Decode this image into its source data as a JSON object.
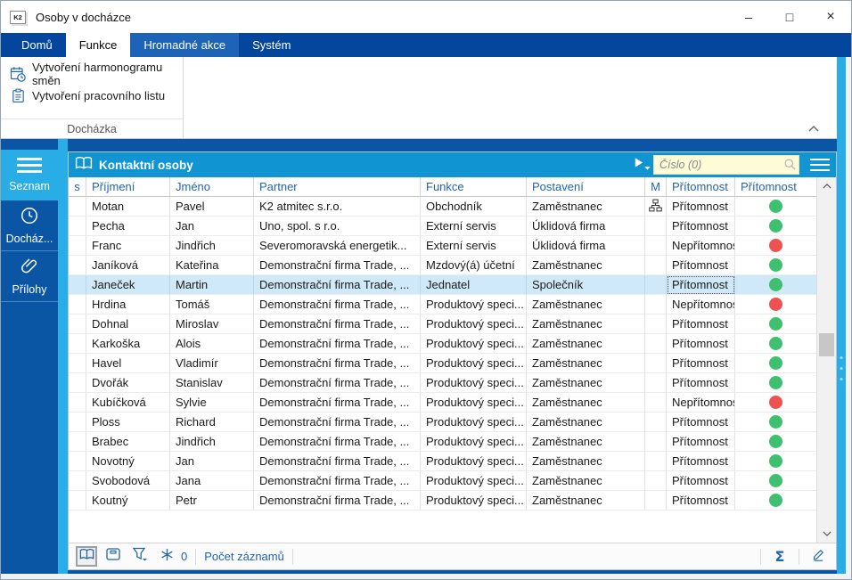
{
  "window": {
    "title": "Osoby v docházce",
    "logo": "K2",
    "controls": {
      "minimize": "–",
      "maximize": "□",
      "close": "×"
    }
  },
  "ribbon": {
    "tabs": [
      {
        "label": "Domů",
        "state": "normal"
      },
      {
        "label": "Funkce",
        "state": "active"
      },
      {
        "label": "Hromadné akce",
        "state": "highlighted"
      },
      {
        "label": "Systém",
        "state": "normal"
      }
    ],
    "group_label": "Docházka",
    "items": [
      {
        "label": "Vytvoření harmonogramu směn",
        "icon": "calendar-clock-icon"
      },
      {
        "label": "Vytvoření pracovního listu",
        "icon": "clipboard-icon"
      }
    ]
  },
  "sidebar": {
    "items": [
      {
        "label": "Seznam",
        "icon": "menu-icon",
        "active": true
      },
      {
        "label": "Docház...",
        "icon": "clock-icon",
        "active": false
      },
      {
        "label": "Přílohy",
        "icon": "paperclip-icon",
        "active": false
      }
    ]
  },
  "panel": {
    "title": "Kontaktní osoby",
    "search_placeholder": "Číslo (0)",
    "columns": [
      "s",
      "Příjmení",
      "Jméno",
      "Partner",
      "Funkce",
      "Postavení",
      "M",
      "Přítomnost",
      "Přítomnost"
    ],
    "rows": [
      {
        "last": "Motan",
        "first": "Pavel",
        "partner": "K2 atmitec s.r.o.",
        "role": "Obchodník",
        "position": "Zaměstnanec",
        "m": true,
        "presence": "Přítomnost",
        "status": "green",
        "selected": false
      },
      {
        "last": "Pecha",
        "first": "Jan",
        "partner": "Uno, spol. s r.o.",
        "role": "Externí servis",
        "position": "Úklidová firma",
        "m": false,
        "presence": "Přítomnost",
        "status": "green",
        "selected": false
      },
      {
        "last": "Franc",
        "first": "Jindřich",
        "partner": "Severomoravská energetik...",
        "role": "Externí servis",
        "position": "Úklidová firma",
        "m": false,
        "presence": "Nepřítomnost",
        "status": "red",
        "selected": false
      },
      {
        "last": "Janíková",
        "first": "Kateřina",
        "partner": "Demonstrační firma Trade, ...",
        "role": "Mzdový(á) účetní",
        "position": "Zaměstnanec",
        "m": false,
        "presence": "Přítomnost",
        "status": "green",
        "selected": false
      },
      {
        "last": "Janeček",
        "first": "Martin",
        "partner": "Demonstrační firma Trade, ...",
        "role": "Jednatel",
        "position": "Společník",
        "m": false,
        "presence": "Přítomnost",
        "status": "green",
        "selected": true
      },
      {
        "last": "Hrdina",
        "first": "Tomáš",
        "partner": "Demonstrační firma Trade, ...",
        "role": "Produktový speci...",
        "position": "Zaměstnanec",
        "m": false,
        "presence": "Nepřítomnost",
        "status": "red",
        "selected": false
      },
      {
        "last": "Dohnal",
        "first": "Miroslav",
        "partner": "Demonstrační firma Trade, ...",
        "role": "Produktový speci...",
        "position": "Zaměstnanec",
        "m": false,
        "presence": "Přítomnost",
        "status": "green",
        "selected": false
      },
      {
        "last": "Karkoška",
        "first": "Alois",
        "partner": "Demonstrační firma Trade, ...",
        "role": "Produktový speci...",
        "position": "Zaměstnanec",
        "m": false,
        "presence": "Přítomnost",
        "status": "green",
        "selected": false
      },
      {
        "last": "Havel",
        "first": "Vladimír",
        "partner": "Demonstrační firma Trade, ...",
        "role": "Produktový speci...",
        "position": "Zaměstnanec",
        "m": false,
        "presence": "Přítomnost",
        "status": "green",
        "selected": false
      },
      {
        "last": "Dvořák",
        "first": "Stanislav",
        "partner": "Demonstrační firma Trade, ...",
        "role": "Produktový speci...",
        "position": "Zaměstnanec",
        "m": false,
        "presence": "Přítomnost",
        "status": "green",
        "selected": false
      },
      {
        "last": "Kubíčková",
        "first": "Sylvie",
        "partner": "Demonstrační firma Trade, ...",
        "role": "Produktový speci...",
        "position": "Zaměstnanec",
        "m": false,
        "presence": "Nepřítomnost",
        "status": "red",
        "selected": false
      },
      {
        "last": "Ploss",
        "first": "Richard",
        "partner": "Demonstrační firma Trade, ...",
        "role": "Produktový speci...",
        "position": "Zaměstnanec",
        "m": false,
        "presence": "Přítomnost",
        "status": "green",
        "selected": false
      },
      {
        "last": "Brabec",
        "first": "Jindřich",
        "partner": "Demonstrační firma Trade, ...",
        "role": "Produktový speci...",
        "position": "Zaměstnanec",
        "m": false,
        "presence": "Přítomnost",
        "status": "green",
        "selected": false
      },
      {
        "last": "Novotný",
        "first": "Jan",
        "partner": "Demonstrační firma Trade, ...",
        "role": "Produktový speci...",
        "position": "Zaměstnanec",
        "m": false,
        "presence": "Přítomnost",
        "status": "green",
        "selected": false
      },
      {
        "last": "Svobodová",
        "first": "Jana",
        "partner": "Demonstrační firma Trade, ...",
        "role": "Produktový speci...",
        "position": "Zaměstnanec",
        "m": false,
        "presence": "Přítomnost",
        "status": "green",
        "selected": false
      },
      {
        "last": "Koutný",
        "first": "Petr",
        "partner": "Demonstrační firma Trade, ...",
        "role": "Produktový speci...",
        "position": "Zaměstnanec",
        "m": false,
        "presence": "Přítomnost",
        "status": "green",
        "selected": false
      }
    ],
    "footer": {
      "filter_count": "0",
      "records_label": "Počet záznamů",
      "sum_symbol": "Σ"
    }
  },
  "colors": {
    "dark_blue": "#0b56a4",
    "tab_bar": "#04459e",
    "tab_highlight": "#1d63b8",
    "cyan": "#29ade6",
    "panel_header": "#1095d2",
    "header_text": "#2265ae",
    "selection": "#cfe9f8",
    "green": "#3fc06f",
    "red": "#ee5250",
    "search_bg": "#fdfbd8"
  }
}
